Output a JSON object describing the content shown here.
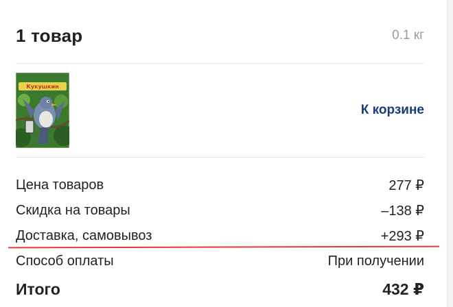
{
  "header": {
    "title": "1 товар",
    "weight": "0.1 кг"
  },
  "products": {
    "cover": {
      "caption": "Кукушкин",
      "colors": {
        "background": "#3b7a2e",
        "bird": "#7a8fb0"
      }
    },
    "to_cart_label": "К корзине"
  },
  "summary": {
    "rows": [
      {
        "label": "Цена товаров",
        "value": "277 ₽"
      },
      {
        "label": "Скидка на товары",
        "value": "–138 ₽"
      },
      {
        "label": "Доставка, самовывоз",
        "value": "+293 ₽"
      },
      {
        "label": "Способ оплаты",
        "value": "При получении"
      }
    ],
    "total": {
      "label": "Итого",
      "value": "432 ₽"
    }
  },
  "colors": {
    "link": "#1d3b74",
    "muted": "#9a9aa2",
    "annotation": "#e53935"
  }
}
